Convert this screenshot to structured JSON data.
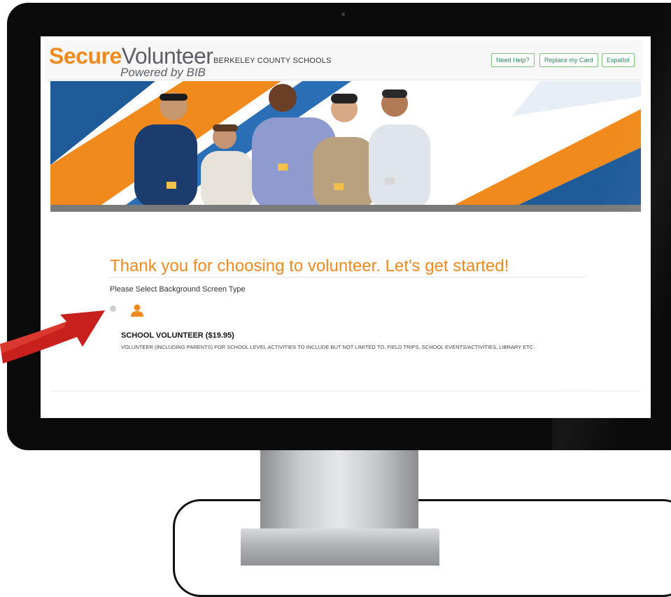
{
  "brand": {
    "secure": "Secure",
    "volunteer": "Volunteer",
    "powered_by": "Powered by BIB"
  },
  "header": {
    "district": "BERKELEY COUNTY SCHOOLS",
    "buttons": {
      "help": "Need Help?",
      "replace_card": "Replace my Card",
      "language": "Español"
    }
  },
  "main": {
    "title": "Thank you for choosing to volunteer. Let's get started!",
    "subtitle": "Please Select Background Screen Type",
    "options": [
      {
        "name": "SCHOOL VOLUNTEER ($19.95)",
        "description": "VOLUNTEER (INCLUDING PARENTS) FOR SCHOOL LEVEL ACTIVITIES TO INCLUDE BUT NOT LIMITED TO, FIELD TRIPS, SCHOOL EVENTS/ACTIVITIES, LIBRARY ETC.",
        "selected": false,
        "icon": "person-icon"
      }
    ]
  },
  "colors": {
    "brand_orange": "#f08a1c",
    "brand_gray": "#5c6066",
    "button_green": "#2e8b57",
    "banner_blue": "#1f5a99",
    "arrow_red": "#c8201c"
  }
}
